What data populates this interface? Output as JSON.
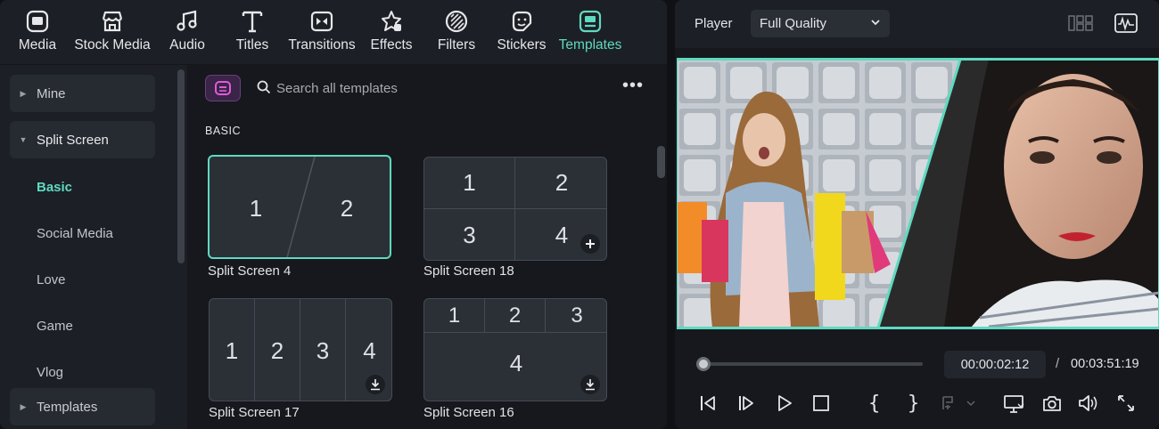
{
  "toolbar": {
    "items": [
      {
        "label": "Media",
        "icon": "media-icon"
      },
      {
        "label": "Stock Media",
        "icon": "stock-media-icon"
      },
      {
        "label": "Audio",
        "icon": "music-note-icon"
      },
      {
        "label": "Titles",
        "icon": "text-t-icon"
      },
      {
        "label": "Transitions",
        "icon": "transition-icon"
      },
      {
        "label": "Effects",
        "icon": "sparkle-icon"
      },
      {
        "label": "Filters",
        "icon": "filter-icon"
      },
      {
        "label": "Stickers",
        "icon": "sticker-icon"
      },
      {
        "label": "Templates",
        "icon": "templates-icon",
        "active": true
      }
    ],
    "accent_color": "#5fd9c0"
  },
  "sidebar": {
    "mine": "Mine",
    "split_screen": "Split Screen",
    "subitems": [
      "Basic",
      "Social Media",
      "Love",
      "Game",
      "Vlog"
    ],
    "active_subitem": "Basic",
    "templates": "Templates"
  },
  "content": {
    "search_placeholder": "Search all templates",
    "section_title": "BASIC",
    "cards": [
      {
        "caption": "Split Screen 4",
        "cells": [
          "1",
          "2"
        ],
        "selected": true
      },
      {
        "caption": "Split Screen 18",
        "cells": [
          "1",
          "2",
          "3",
          "4"
        ],
        "action": "add"
      },
      {
        "caption": "Split Screen 17",
        "cells": [
          "1",
          "2",
          "3",
          "4"
        ],
        "action": "download"
      },
      {
        "caption": "Split Screen 16",
        "cells": [
          "1",
          "2",
          "3",
          "4"
        ],
        "action": "download"
      }
    ]
  },
  "player": {
    "label": "Player",
    "quality": "Full Quality",
    "current_time": "00:00:02:12",
    "separator": "/",
    "total_time": "00:03:51:19",
    "progress": 0.01
  }
}
